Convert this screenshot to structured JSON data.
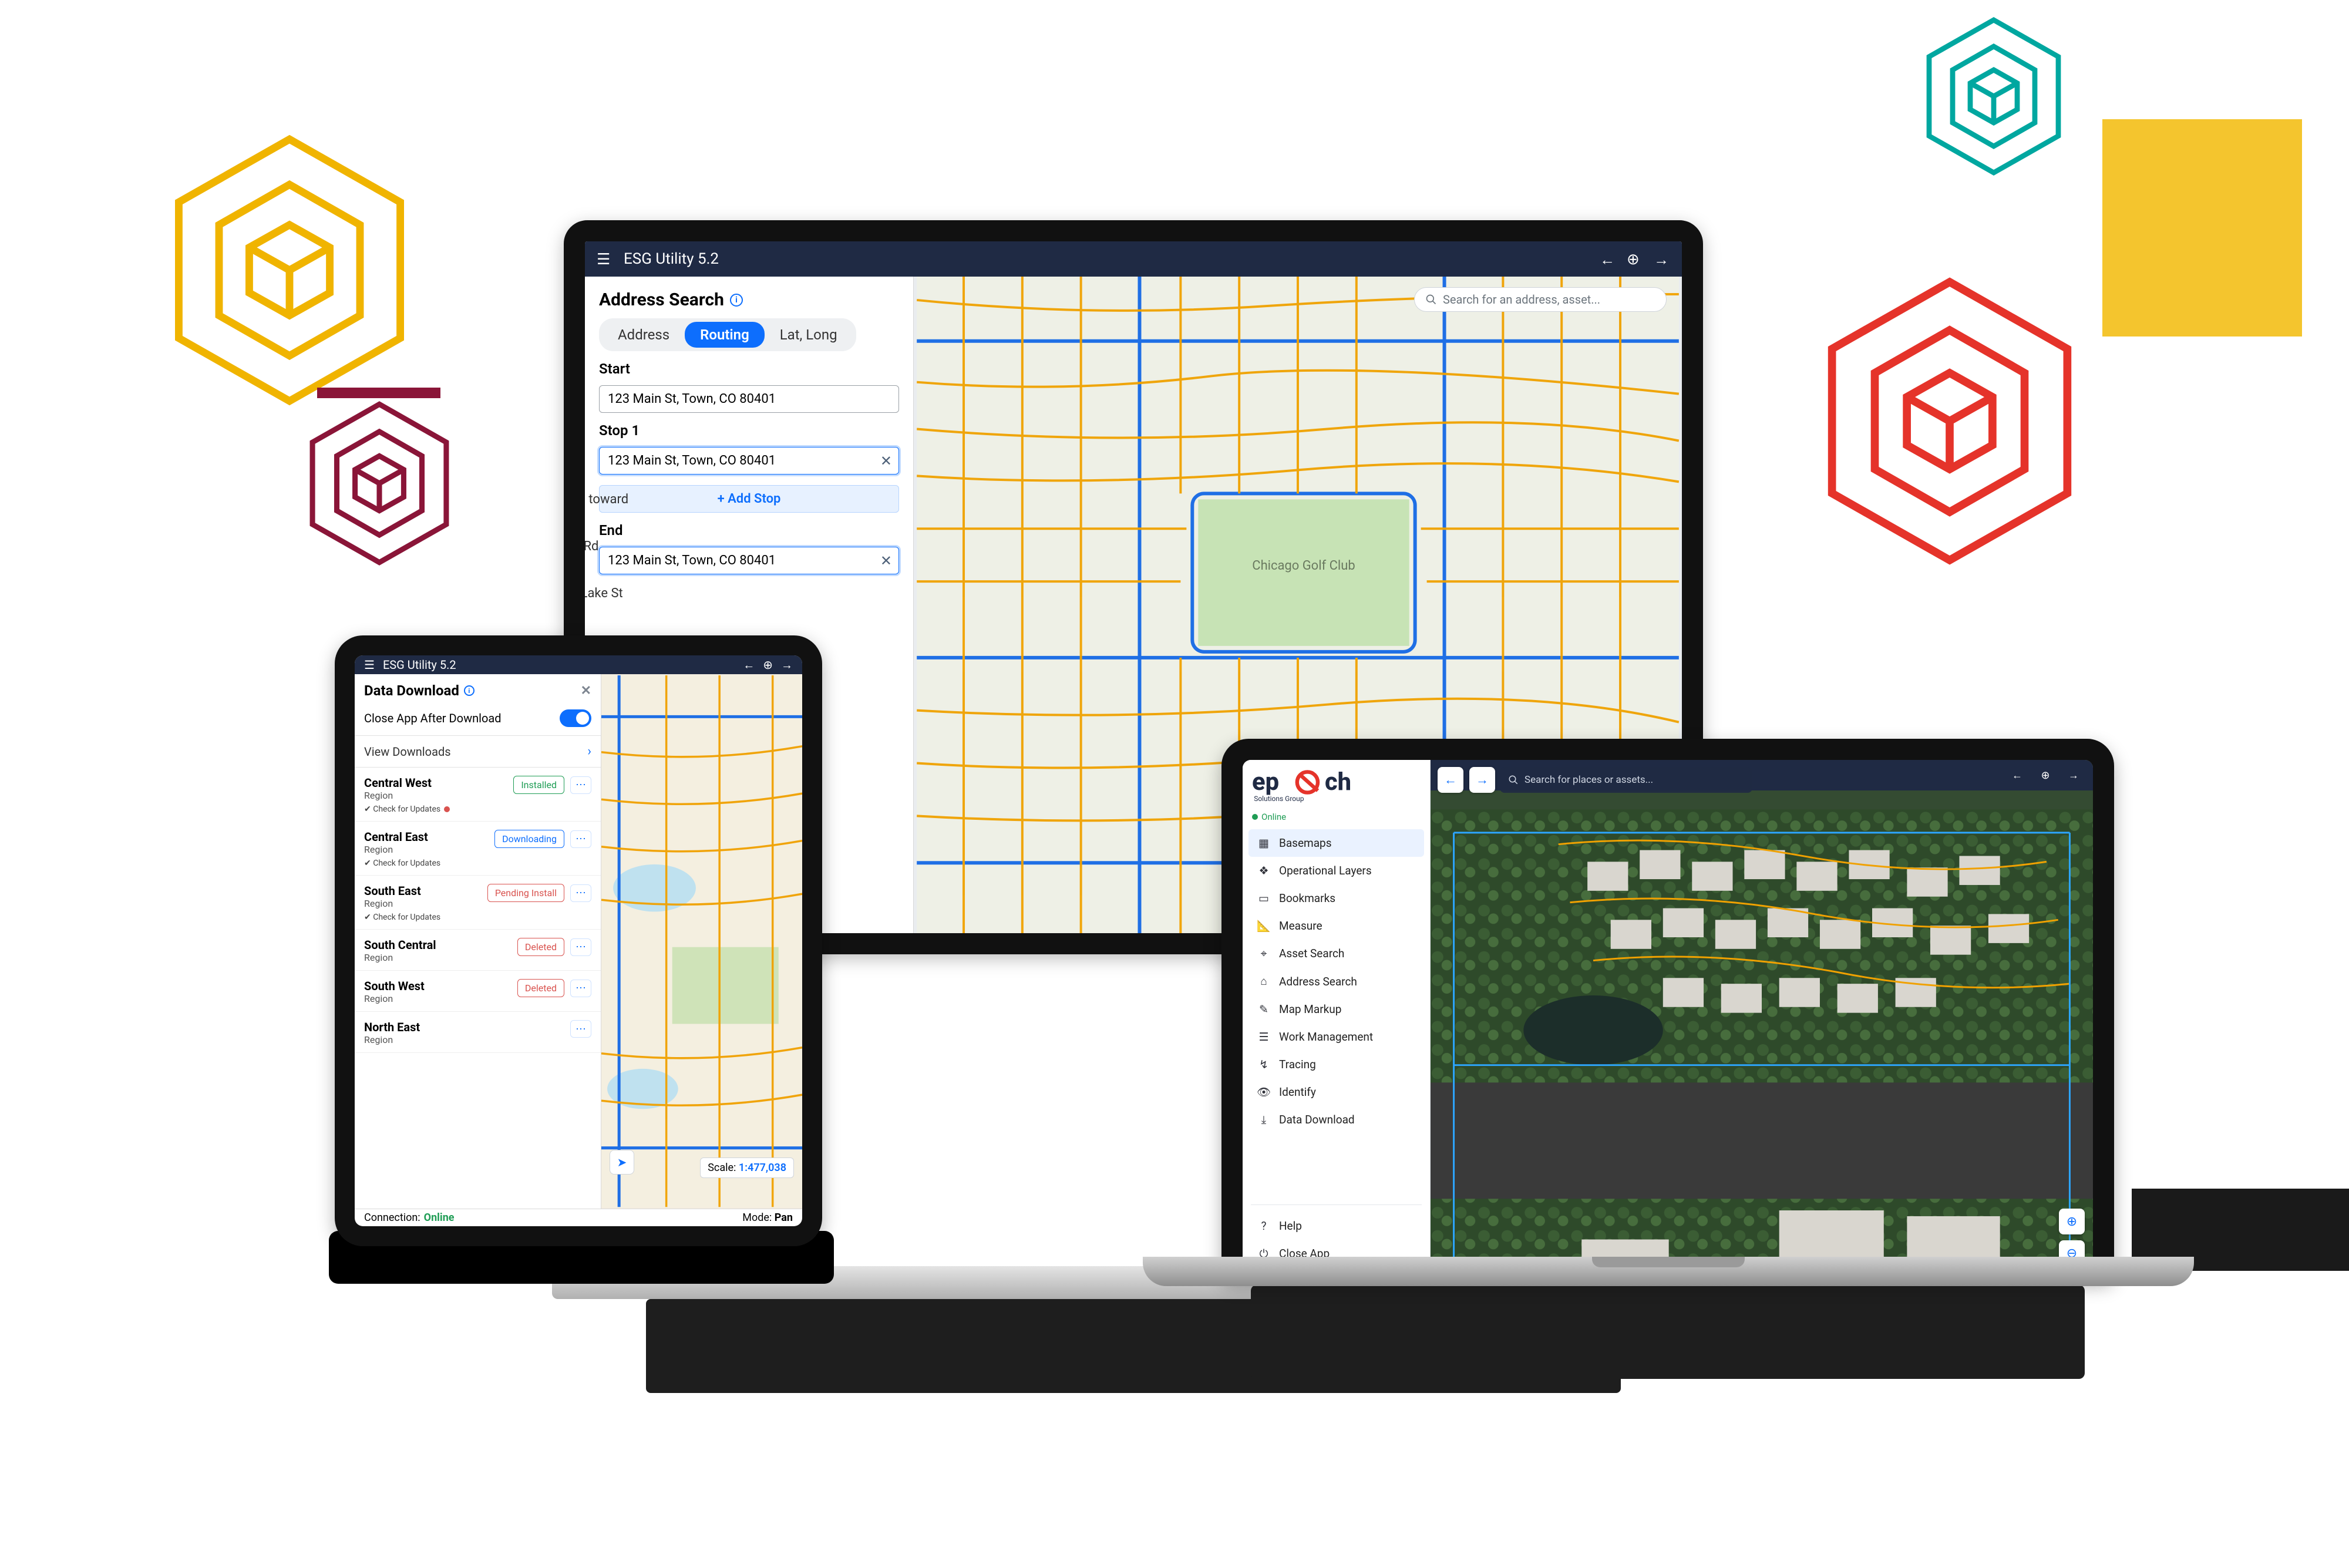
{
  "colors": {
    "accent": "#0d6efd",
    "header": "#1f2a44",
    "success": "#1f9d55",
    "danger": "#d9534f",
    "road": "#f0a100",
    "water": "#0d6efd"
  },
  "monitor": {
    "app_title": "ESG Utility 5.2",
    "panel_title": "Address Search",
    "tabs": {
      "address": "Address",
      "routing": "Routing",
      "latlong": "Lat, Long",
      "active": "routing"
    },
    "start_label": "Start",
    "start_value": "123 Main St, Town, CO 80401",
    "stop1_label": "Stop 1",
    "stop1_value": "123 Main St, Town, CO 80401",
    "add_stop": "+  Add Stop",
    "end_label": "End",
    "end_value": "123 Main St, Town, CO 80401",
    "search_placeholder": "Search for an address, asset...",
    "directions_hints": [
      "Rd toward",
      "le Rd",
      "n Lake St"
    ],
    "map_poi_label": "Chicago Golf Club"
  },
  "tablet": {
    "app_title": "ESG Utility 5.2",
    "panel_title": "Data Download",
    "close_after_label": "Close App After Download",
    "close_after_value": true,
    "view_downloads": "View Downloads",
    "items": [
      {
        "name": "Central West",
        "sub": "Region",
        "status": "Installed",
        "status_class": "installed",
        "check": true,
        "check_dot": true
      },
      {
        "name": "Central East",
        "sub": "Region",
        "status": "Downloading",
        "status_class": "downloading",
        "check": true,
        "check_dot": false
      },
      {
        "name": "South East",
        "sub": "Region",
        "status": "Pending Install",
        "status_class": "pending",
        "check": true,
        "check_dot": false
      },
      {
        "name": "South Central",
        "sub": "Region",
        "status": "Deleted",
        "status_class": "deleted",
        "check": false,
        "check_dot": false
      },
      {
        "name": "South West",
        "sub": "Region",
        "status": "Deleted",
        "status_class": "deleted",
        "check": false,
        "check_dot": false
      },
      {
        "name": "North East",
        "sub": "Region",
        "status": "",
        "status_class": "",
        "check": false,
        "check_dot": false
      }
    ],
    "check_label": "Check for Updates",
    "scale_label": "Scale:",
    "scale_value": "1:477,038",
    "connection_label": "Connection:",
    "connection_value": "Online",
    "mode_label": "Mode:",
    "mode_value": "Pan"
  },
  "laptop": {
    "brand": "epoch",
    "brand_sub": "Solutions Group",
    "status": "Online",
    "sidebar": [
      {
        "label": "Basemaps",
        "icon": "▦",
        "selected": true
      },
      {
        "label": "Operational Layers",
        "icon": "❖",
        "selected": false
      },
      {
        "label": "Bookmarks",
        "icon": "▭",
        "selected": false
      },
      {
        "label": "Measure",
        "icon": "📐",
        "selected": false
      },
      {
        "label": "Asset Search",
        "icon": "⌖",
        "selected": false
      },
      {
        "label": "Address Search",
        "icon": "⌂",
        "selected": false
      },
      {
        "label": "Map Markup",
        "icon": "✎",
        "selected": false
      },
      {
        "label": "Work Management",
        "icon": "☰",
        "selected": false
      },
      {
        "label": "Tracing",
        "icon": "↯",
        "selected": false
      },
      {
        "label": "Identify",
        "icon": "👁",
        "selected": false
      },
      {
        "label": "Data Download",
        "icon": "⤓",
        "selected": false
      }
    ],
    "footer": [
      {
        "label": "Help",
        "icon": "?"
      },
      {
        "label": "Close App",
        "icon": "⏻"
      }
    ],
    "search_placeholder": "Search for places or assets..."
  }
}
